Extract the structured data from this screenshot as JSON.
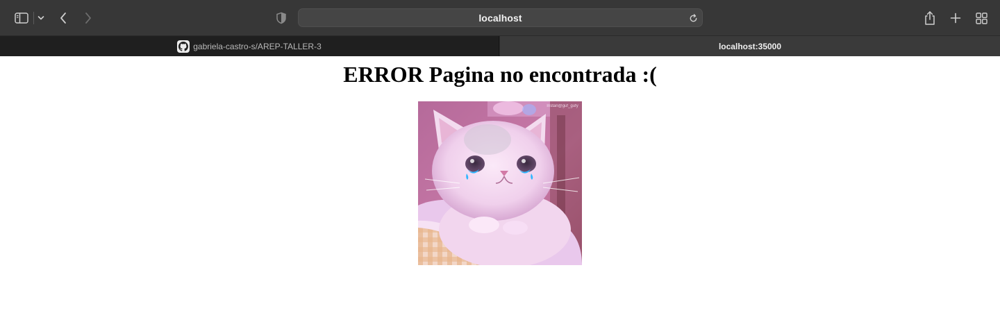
{
  "browser": {
    "address": "localhost",
    "tabs": [
      {
        "label": "gabriela-castro-s/AREP-TALLER-3",
        "favicon": "github-icon",
        "active": false
      },
      {
        "label": "localhost:35000",
        "active": true
      }
    ],
    "toolbar_icons": [
      "sidebar-icon",
      "chevron-down-icon",
      "back-icon",
      "forward-icon",
      "shield-icon",
      "reload-icon",
      "share-icon",
      "plus-icon",
      "tab-overview-icon"
    ]
  },
  "page": {
    "heading": "ERROR Pagina no encontrada :(",
    "image": {
      "description": "crying-cat-photo",
      "watermark": "Instan@guf_gufy"
    }
  },
  "colors": {
    "toolbar_bg": "#373737",
    "tabstrip_bg": "#2a2a2a",
    "active_tab_bg": "#3a3a3a",
    "page_bg": "#ffffff"
  }
}
